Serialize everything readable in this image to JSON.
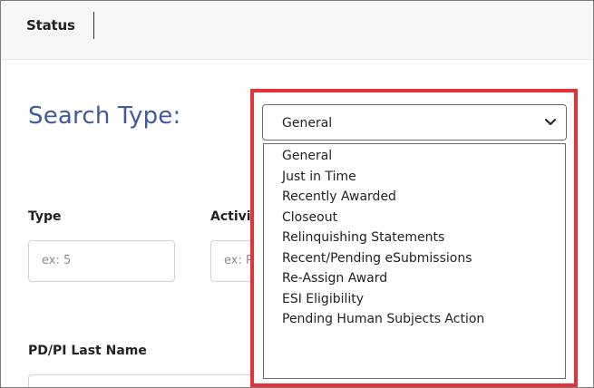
{
  "topbar": {
    "tab_label": "Status"
  },
  "search_type": {
    "heading": "Search Type:",
    "selected": "General",
    "options": [
      "General",
      "Just in Time",
      "Recently Awarded",
      "Closeout",
      "Relinquishing Statements",
      "Recent/Pending eSubmissions",
      "Re-Assign Award",
      "ESI Eligibility",
      "Pending Human Subjects Action"
    ]
  },
  "fields": {
    "type_label": "Type",
    "type_placeholder": "ex: 5",
    "activity_label": "Activity",
    "activity_placeholder": "ex: R",
    "pd_label": "PD/PI Last Name"
  },
  "colors": {
    "heading": "#3f5a9e",
    "highlight_border": "#e53238"
  },
  "icons": {
    "select_arrow": "chevron-down-icon"
  }
}
